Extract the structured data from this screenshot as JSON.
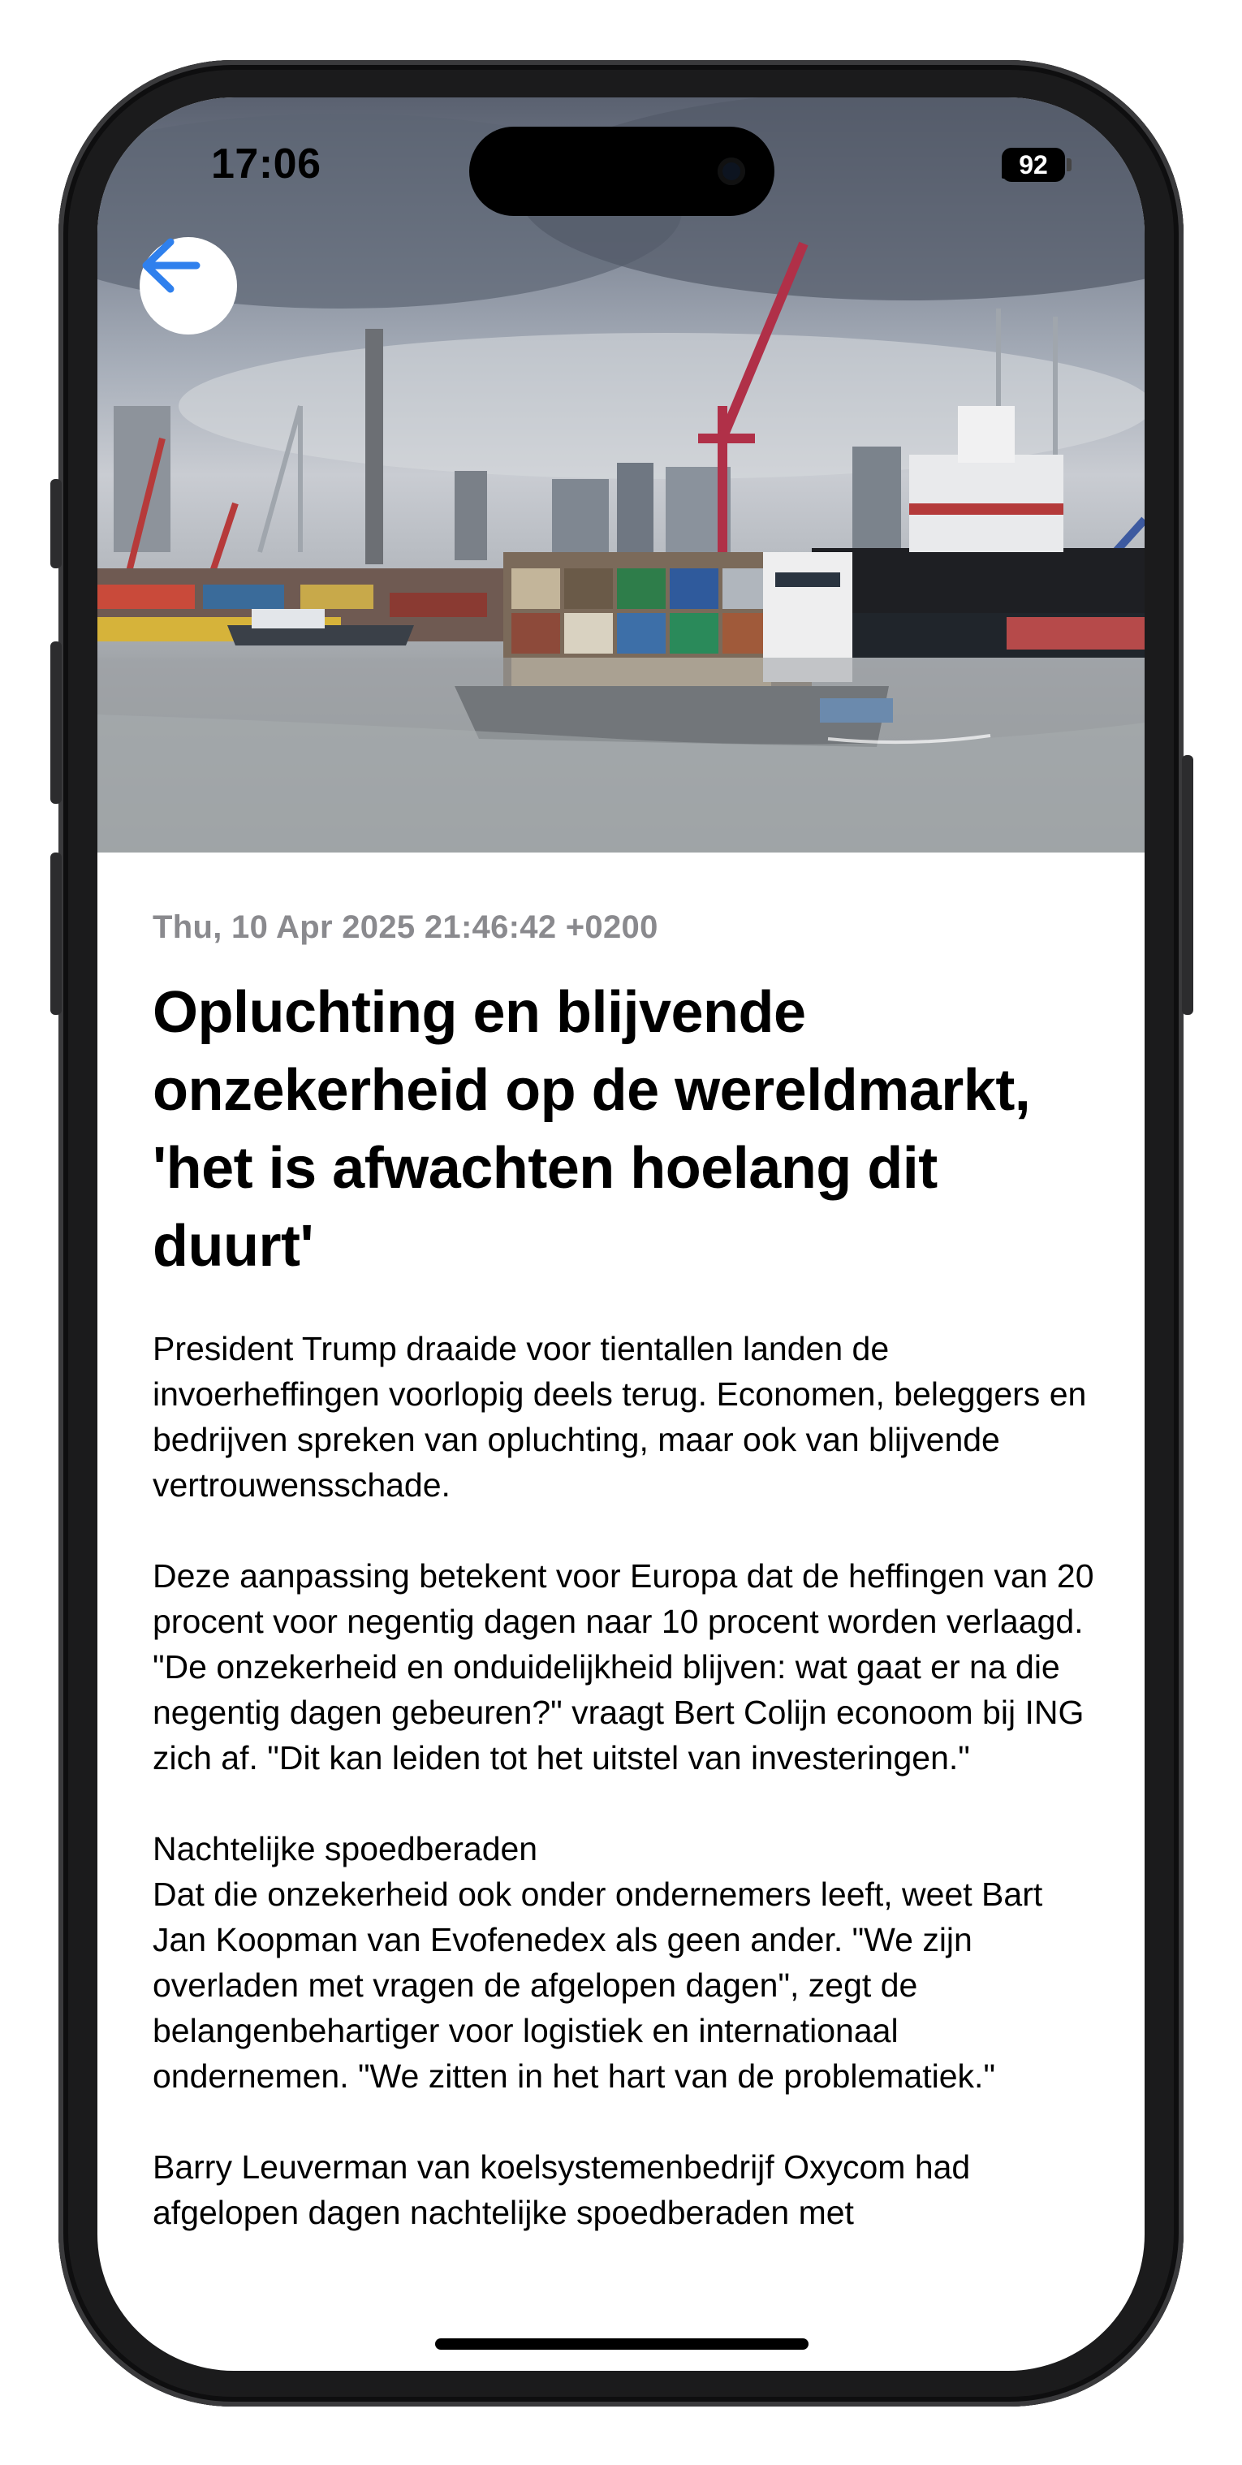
{
  "status_bar": {
    "time": "17:06",
    "battery": "92",
    "icons": [
      "signal-icon",
      "wifi-icon",
      "battery-icon"
    ]
  },
  "navigation": {
    "back_icon": "arrow-left-icon",
    "accent_color": "#2f80ed"
  },
  "article": {
    "date": "Thu, 10 Apr 2025 21:46:42 +0200",
    "title": "Opluchting en blijvende onzekerheid op de wereldmarkt, 'het is afwachten hoelang dit duurt'",
    "paragraphs": [
      "President Trump draaide voor tientallen landen de invoerheffingen voorlopig deels terug. Economen, beleggers en bedrijven spreken van opluchting, maar ook van blijvende vertrouwensschade.",
      "Deze aanpassing betekent voor Europa dat de heffingen van 20 procent voor negentig dagen naar 10 procent worden verlaagd. \"De onzekerheid en onduidelijkheid blijven: wat gaat er na die negentig dagen gebeuren?\" vraagt Bert Colijn econoom bij ING zich af. \"Dit kan leiden tot het uitstel van investeringen.\"",
      "Nachtelijke spoedberaden",
      "Dat die onzekerheid ook onder ondernemers leeft, weet Bart Jan Koopman van Evofenedex als geen ander. \"We zijn overladen met vragen de afgelopen dagen\", zegt de belangenbehartiger voor logistiek en internationaal ondernemen. \"We zitten in het hart van de problematiek.\"",
      "Barry Leuverman van koelsystemenbedrijf Oxycom had afgelopen dagen nachtelijke spoedberaden met"
    ]
  }
}
